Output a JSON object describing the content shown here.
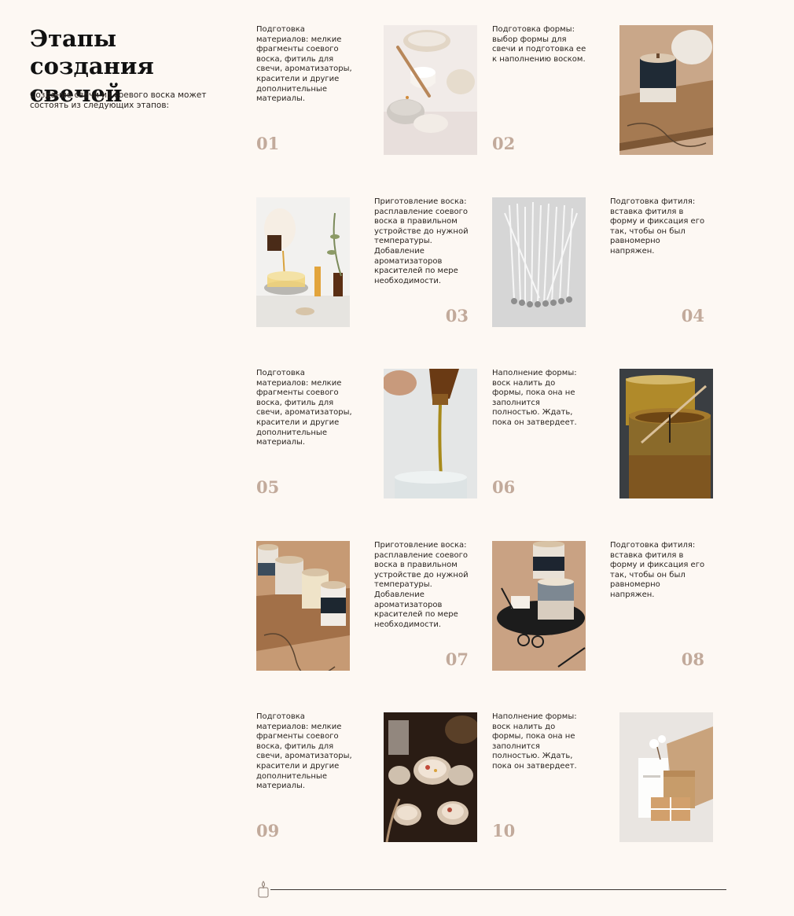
{
  "header": {
    "title": "Этапы создания свечей",
    "subtitle": "Создание свечи из соевого воска может состоять из следующих этапов:"
  },
  "steps": [
    {
      "num": "01",
      "text": "Подготовка материалов: мелкие фрагменты соевого воска, фитиль для свечи, ароматизаторы, красители и другие дополнительные материалы."
    },
    {
      "num": "02",
      "text": "Подготовка формы: выбор формы для свечи и подготовка ее к наполнению воском."
    },
    {
      "num": "03",
      "text": "Приготовление воска: расплавление соевого воска в правильном устройстве до нужной температуры. Добавление ароматизаторов красителей по мере необходимости."
    },
    {
      "num": "04",
      "text": "Подготовка фитиля: вставка фитиля в форму и фиксация его так, чтобы он был равномерно напряжен."
    },
    {
      "num": "05",
      "text": "Подготовка материалов: мелкие фрагменты соевого воска, фитиль для свечи, ароматизаторы, красители и другие дополнительные материалы."
    },
    {
      "num": "06",
      "text": "Наполнение формы: воск налить до формы, пока она не заполнится полностью. Ждать, пока он затвердеет."
    },
    {
      "num": "07",
      "text": "Приготовление воска: расплавление соевого воска в правильном устройстве до нужной температуры. Добавление ароматизаторов красителей по мере необходимости."
    },
    {
      "num": "08",
      "text": "Подготовка фитиля: вставка фитиля в форму и фиксация его так, чтобы он был равномерно напряжен."
    },
    {
      "num": "09",
      "text": "Подготовка материалов: мелкие фрагменты соевого воска, фитиль для свечи, ароматизаторы, красители и другие дополнительные материалы."
    },
    {
      "num": "10",
      "text": "Наполнение формы: воск налить до формы, пока она не заполнится полностью. Ждать, пока он затвердеет."
    }
  ],
  "icons": {
    "footer": "candle-icon"
  },
  "colors": {
    "background": "#fdf8f3",
    "step_number": "#c2aa9b",
    "text": "#2a2420"
  }
}
